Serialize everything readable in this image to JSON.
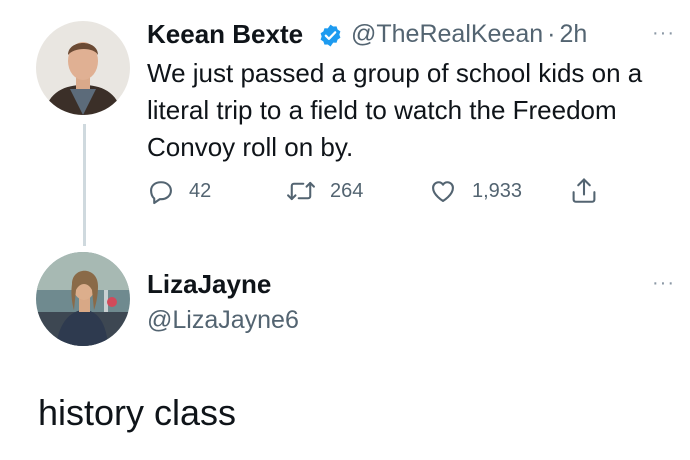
{
  "tweet": {
    "author_name": "Keean Bexte",
    "verified_icon": "verified-badge-icon",
    "author_handle": "@TheRealKeean",
    "separator": "·",
    "time": "2h",
    "text": "We just passed a group of school kids on a literal trip to a field to watch the Freedom Convoy roll on by.",
    "more": "···",
    "actions": {
      "reply_icon": "reply-icon",
      "reply_count": "42",
      "retweet_icon": "retweet-icon",
      "retweet_count": "264",
      "like_icon": "heart-icon",
      "like_count": "1,933",
      "share_icon": "share-icon"
    }
  },
  "reply": {
    "author_name": "LizaJayne",
    "author_handle": "@LizaJayne6",
    "more": "···",
    "text": "history class"
  },
  "colors": {
    "verified": "#1d9bf0",
    "secondary_text": "#536471",
    "thread_line": "#cfd9de"
  }
}
